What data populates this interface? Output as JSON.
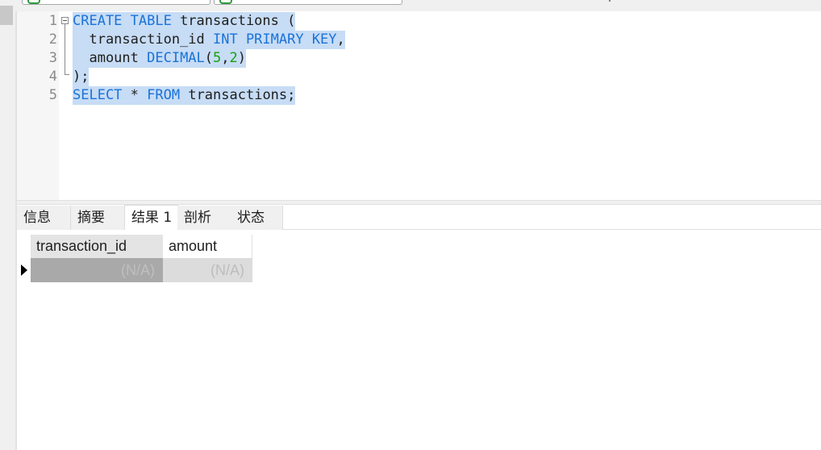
{
  "editor": {
    "lines": [
      {
        "num": "1"
      },
      {
        "num": "2"
      },
      {
        "num": "3"
      },
      {
        "num": "4"
      },
      {
        "num": "5"
      }
    ],
    "tokens": {
      "l1_kw": "CREATE TABLE",
      "l1_txt": " transactions (",
      "l2_indent": "  transaction_id ",
      "l2_kw": "INT PRIMARY KEY",
      "l2_tail": ",",
      "l3_indent": "  amount ",
      "l3_kw": "DECIMAL",
      "l3_p1": "(",
      "l3_n1": "5",
      "l3_c": ",",
      "l3_n2": "2",
      "l3_p2": ")",
      "l4_txt": ");",
      "l5_kw1": "SELECT",
      "l5_mid": " * ",
      "l5_kw2": "FROM",
      "l5_tail": " transactions;"
    }
  },
  "results": {
    "tabs": [
      "信息",
      "摘要",
      "结果 1",
      "剖析",
      "状态"
    ],
    "active_tab": "结果 1",
    "columns": [
      "transaction_id",
      "amount"
    ],
    "rows": [
      [
        "(N/A)",
        "(N/A)"
      ]
    ]
  },
  "colors": {
    "keyword": "#1a73d9",
    "number": "#13a10e",
    "selection": "#c7dcf5"
  }
}
